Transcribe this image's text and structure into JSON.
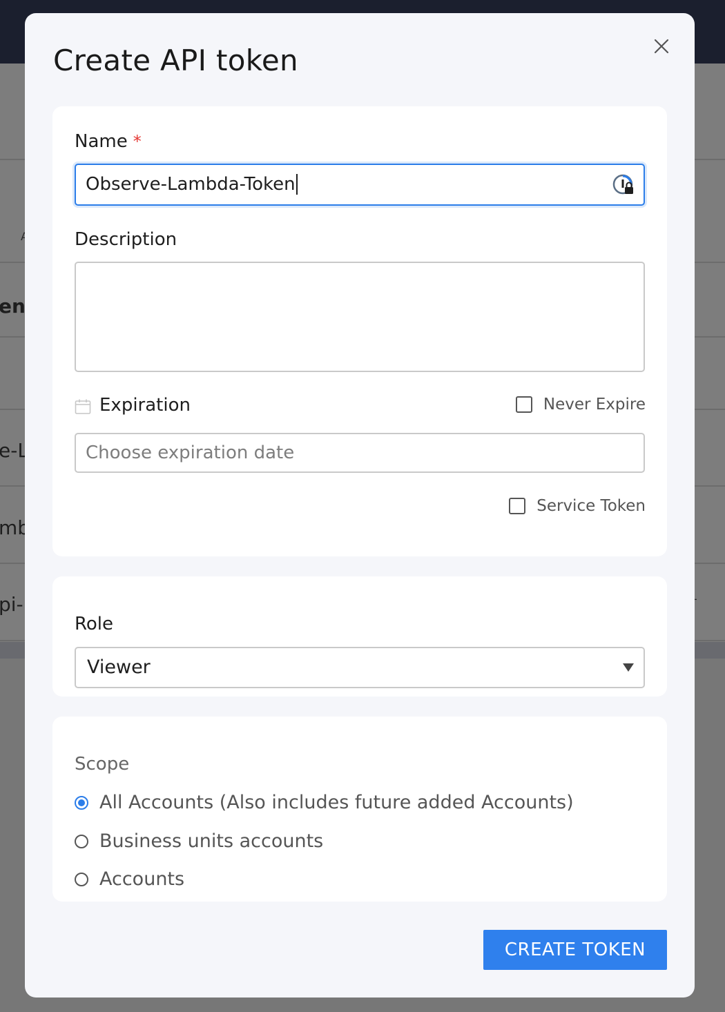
{
  "background": {
    "fragments": [
      "A",
      "ens",
      "e-L",
      "mb",
      "pi-",
      "-"
    ]
  },
  "modal": {
    "title": "Create API token",
    "close_icon": "close-icon"
  },
  "details": {
    "name_label": "Name",
    "required_marker": "*",
    "name_value": "Observe-Lambda-Token",
    "password_manager_icon": "password-manager-icon",
    "description_label": "Description",
    "description_value": "",
    "expiration_icon": "calendar-icon",
    "expiration_label": "Expiration",
    "never_expire_label": "Never Expire",
    "never_expire_checked": false,
    "expiration_placeholder": "Choose expiration date",
    "service_token_label": "Service Token",
    "service_token_checked": false
  },
  "role": {
    "label": "Role",
    "selected": "Viewer"
  },
  "scope": {
    "label": "Scope",
    "options": [
      {
        "label": "All Accounts (Also includes future added Accounts)",
        "checked": true
      },
      {
        "label": "Business units accounts",
        "checked": false
      },
      {
        "label": "Accounts",
        "checked": false
      }
    ]
  },
  "actions": {
    "create_label": "CREATE TOKEN"
  },
  "colors": {
    "accent": "#2f80ed",
    "focus_border": "#2b7de9",
    "required": "#e53935",
    "overlay": "#7d7d7d",
    "topbar": "#1b1f2e"
  }
}
